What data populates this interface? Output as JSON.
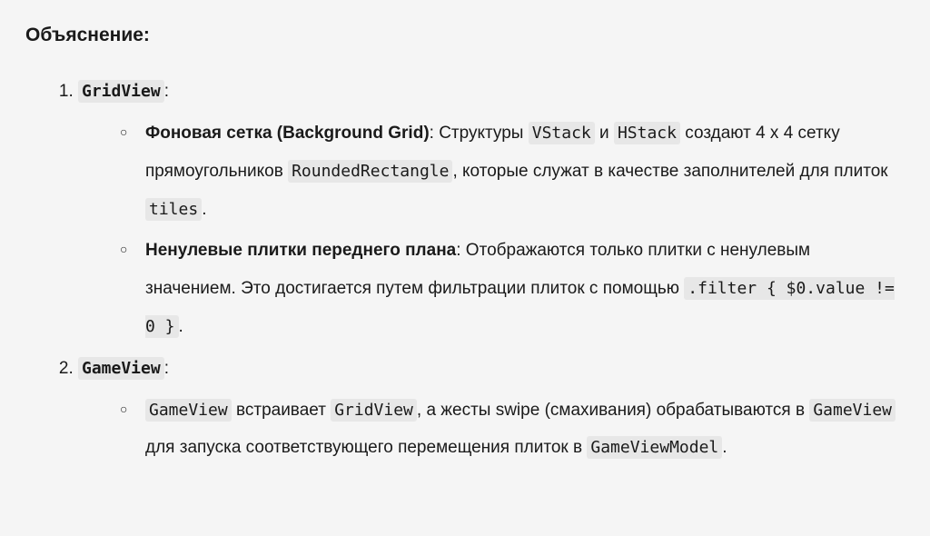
{
  "heading": "Объяснение:",
  "list": {
    "item1": {
      "head_code": "GridView",
      "head_suffix": ":",
      "sub": {
        "a": {
          "strong": "Фоновая сетка (Background Grid)",
          "t1": ": Структуры ",
          "c1": "VStack",
          "t2": " и ",
          "c2": "HStack",
          "t3": " создают 4 x 4 сетку прямоугольников ",
          "c3": "RoundedRectangle",
          "t4": ", которые служат в качестве заполнителей для плиток ",
          "c4": "tiles",
          "t5": "."
        },
        "b": {
          "strong": "Ненулевые плитки переднего плана",
          "t1": ": Отображаются только плитки с ненулевым значением. Это достигается путем фильтрации плиток с помощью ",
          "c1": ".filter { $0.value != 0 }",
          "t2": "."
        }
      }
    },
    "item2": {
      "head_code": "GameView",
      "head_suffix": ":",
      "sub": {
        "a": {
          "c1": "GameView",
          "t1": " встраивает ",
          "c2": "GridView",
          "t2": ", а жесты swipe (смахивания) обрабатываются в ",
          "c3": "GameView",
          "t3": " для запуска соответствующего  перемещения плиток в ",
          "c4": "GameViewModel",
          "t4": "."
        }
      }
    }
  }
}
